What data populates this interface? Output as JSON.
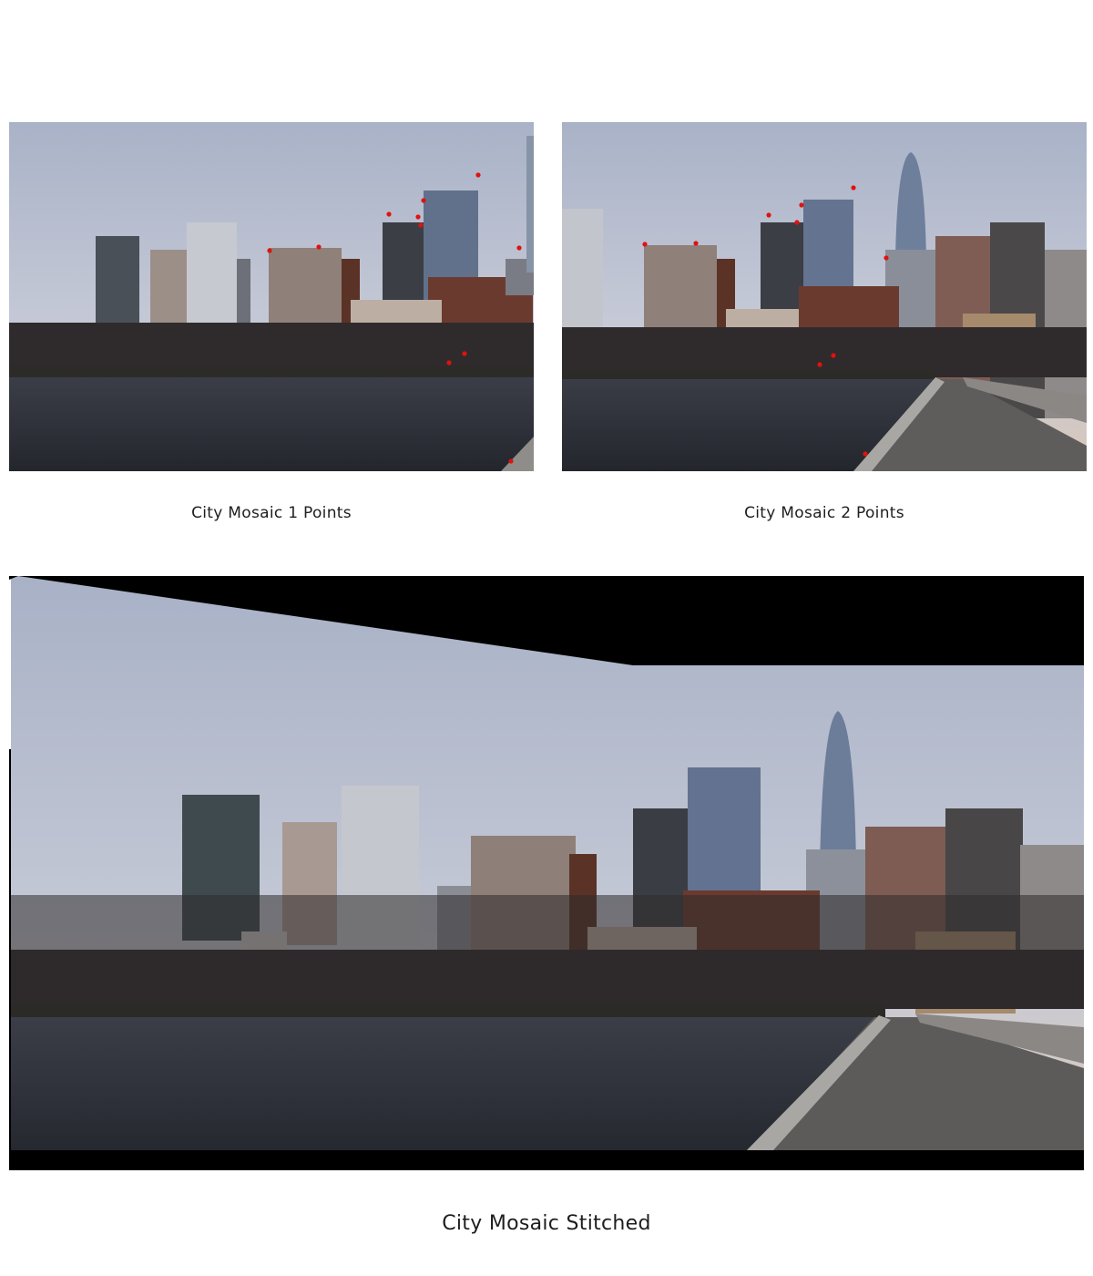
{
  "figures": [
    {
      "caption": "City Mosaic 1 Points",
      "point_color": "#e0120f"
    },
    {
      "caption": "City Mosaic 2 Points",
      "point_color": "#e0120f"
    },
    {
      "caption": "City Mosaic Stitched"
    }
  ],
  "colors": {
    "sky_top": "#aab3c8",
    "sky_mid": "#c4c9d6",
    "sky_horizon": "#d9c6b6",
    "water": "#2b2f38",
    "buildings_dark": "#2e2c30",
    "buildings_brick": "#6b3a2e",
    "buildings_light": "#b9b1ad",
    "glass_tower": "#6f7f95",
    "mask_black": "#000000"
  }
}
